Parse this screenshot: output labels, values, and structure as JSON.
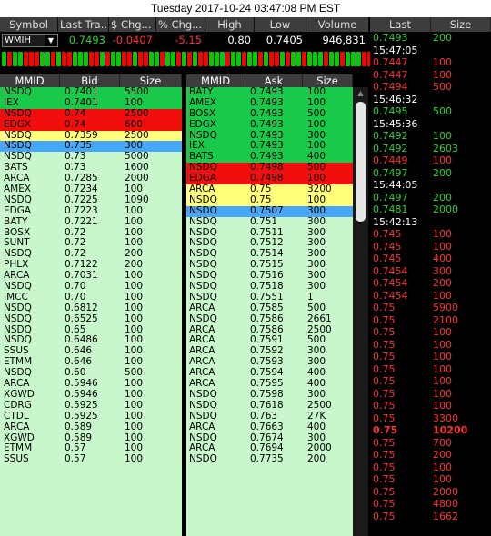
{
  "window": {
    "title": "Tuesday 2017-10-24 03:47:08 PM EST"
  },
  "quote": {
    "headers": {
      "symbol": "Symbol",
      "last": "Last Tra...",
      "chg": "$ Chg...",
      "pct": "% Chg...",
      "high": "High",
      "low": "Low",
      "volume": "Volume"
    },
    "symbol": "WMIH",
    "last": "0.7493",
    "chg": "-0.0407",
    "pct": "-5.15",
    "high": "0.80",
    "low": "0.7405",
    "volume": "946,831"
  },
  "tick_history": [
    "#0c0",
    "#f00",
    "#0c0",
    "#0c0",
    "#f00",
    "#f00",
    "#f00",
    "#0c0",
    "#0c0",
    "#f00",
    "#0c0",
    "#f00",
    "#f00",
    "#0c0",
    "#0c0",
    "#0c0",
    "#f00",
    "#f00",
    "#0c0",
    "#f00",
    "#0c0",
    "#0c0",
    "#f00",
    "#f00",
    "#0c0",
    "#f00",
    "#f00",
    "#0c0",
    "#0c0",
    "#f00",
    "#0c0",
    "#0c0",
    "#f00",
    "#0c0",
    "#f00",
    "#0c0",
    "#f00",
    "#f00",
    "#0c0",
    "#0c0",
    "#0c0",
    "#f00",
    "#0c0",
    "#0c0",
    "#f00",
    "#0c0",
    "#0c0",
    "#f00",
    "#0c0",
    "#f00",
    "#f00",
    "#0c0",
    "#f00",
    "#0c0",
    "#0c0",
    "#f00",
    "#0c0",
    "#0c0",
    "#0c0",
    "#f00",
    "#0c0",
    "#0c0",
    "#f00",
    "#0c0",
    "#0c0",
    "#0c0",
    "#f00",
    "#f00"
  ],
  "bid_panel": {
    "headers": {
      "mmid": "MMID",
      "price": "Bid",
      "size": "Size"
    },
    "rows": [
      {
        "mmid": "NSDQ",
        "price": "0.7401",
        "size": "5500",
        "color": "g"
      },
      {
        "mmid": "IEX",
        "price": "0.7401",
        "size": "100",
        "color": "g"
      },
      {
        "mmid": "NSDQ",
        "price": "0.74",
        "size": "2500",
        "color": "r"
      },
      {
        "mmid": "EDGX",
        "price": "0.74",
        "size": "600",
        "color": "r"
      },
      {
        "mmid": "NSDQ",
        "price": "0.7359",
        "size": "2500",
        "color": "y"
      },
      {
        "mmid": "NSDQ",
        "price": "0.735",
        "size": "300",
        "color": "b"
      },
      {
        "mmid": "NSDQ",
        "price": "0.73",
        "size": "5000",
        "color": "l"
      },
      {
        "mmid": "BATS",
        "price": "0.73",
        "size": "1600",
        "color": "l"
      },
      {
        "mmid": "ARCA",
        "price": "0.7285",
        "size": "2000",
        "color": "l"
      },
      {
        "mmid": "AMEX",
        "price": "0.7234",
        "size": "100",
        "color": "l"
      },
      {
        "mmid": "NSDQ",
        "price": "0.7225",
        "size": "1090",
        "color": "l"
      },
      {
        "mmid": "EDGA",
        "price": "0.7223",
        "size": "100",
        "color": "l"
      },
      {
        "mmid": "BATY",
        "price": "0.7221",
        "size": "100",
        "color": "l"
      },
      {
        "mmid": "BOSX",
        "price": "0.72",
        "size": "100",
        "color": "l"
      },
      {
        "mmid": "SUNT",
        "price": "0.72",
        "size": "100",
        "color": "l"
      },
      {
        "mmid": "NSDQ",
        "price": "0.72",
        "size": "200",
        "color": "l"
      },
      {
        "mmid": "PHLX",
        "price": "0.7122",
        "size": "200",
        "color": "l"
      },
      {
        "mmid": "ARCA",
        "price": "0.7031",
        "size": "100",
        "color": "l"
      },
      {
        "mmid": "NSDQ",
        "price": "0.70",
        "size": "100",
        "color": "l"
      },
      {
        "mmid": "IMCC",
        "price": "0.70",
        "size": "100",
        "color": "l"
      },
      {
        "mmid": "NSDQ",
        "price": "0.6812",
        "size": "100",
        "color": "l"
      },
      {
        "mmid": "NSDQ",
        "price": "0.6525",
        "size": "100",
        "color": "l"
      },
      {
        "mmid": "NSDQ",
        "price": "0.65",
        "size": "100",
        "color": "l"
      },
      {
        "mmid": "NSDQ",
        "price": "0.6486",
        "size": "100",
        "color": "l"
      },
      {
        "mmid": "SSUS",
        "price": "0.646",
        "size": "100",
        "color": "l"
      },
      {
        "mmid": "ETMM",
        "price": "0.646",
        "size": "100",
        "color": "l"
      },
      {
        "mmid": "NSDQ",
        "price": "0.60",
        "size": "500",
        "color": "l"
      },
      {
        "mmid": "ARCA",
        "price": "0.5946",
        "size": "100",
        "color": "l"
      },
      {
        "mmid": "XGWD",
        "price": "0.5946",
        "size": "100",
        "color": "l"
      },
      {
        "mmid": "CDRG",
        "price": "0.5925",
        "size": "100",
        "color": "l"
      },
      {
        "mmid": "CTDL",
        "price": "0.5925",
        "size": "100",
        "color": "l"
      },
      {
        "mmid": "ARCA",
        "price": "0.589",
        "size": "100",
        "color": "l"
      },
      {
        "mmid": "XGWD",
        "price": "0.589",
        "size": "100",
        "color": "l"
      },
      {
        "mmid": "ETMM",
        "price": "0.57",
        "size": "100",
        "color": "l"
      },
      {
        "mmid": "SSUS",
        "price": "0.57",
        "size": "100",
        "color": "l"
      }
    ]
  },
  "ask_panel": {
    "headers": {
      "mmid": "MMID",
      "price": "Ask",
      "size": "Size"
    },
    "rows": [
      {
        "mmid": "BATY",
        "price": "0.7493",
        "size": "100",
        "color": "g"
      },
      {
        "mmid": "AMEX",
        "price": "0.7493",
        "size": "100",
        "color": "g"
      },
      {
        "mmid": "BOSX",
        "price": "0.7493",
        "size": "500",
        "color": "g"
      },
      {
        "mmid": "EDGX",
        "price": "0.7493",
        "size": "100",
        "color": "g"
      },
      {
        "mmid": "NSDQ",
        "price": "0.7493",
        "size": "300",
        "color": "g"
      },
      {
        "mmid": "IEX",
        "price": "0.7493",
        "size": "100",
        "color": "g"
      },
      {
        "mmid": "BATS",
        "price": "0.7493",
        "size": "400",
        "color": "g"
      },
      {
        "mmid": "NSDQ",
        "price": "0.7498",
        "size": "500",
        "color": "r"
      },
      {
        "mmid": "EDGA",
        "price": "0.7498",
        "size": "100",
        "color": "r"
      },
      {
        "mmid": "ARCA",
        "price": "0.75",
        "size": "3200",
        "color": "y"
      },
      {
        "mmid": "NSDQ",
        "price": "0.75",
        "size": "100",
        "color": "y"
      },
      {
        "mmid": "NSDQ",
        "price": "0.7507",
        "size": "300",
        "color": "b"
      },
      {
        "mmid": "NSDQ",
        "price": "0.751",
        "size": "300",
        "color": "l"
      },
      {
        "mmid": "NSDQ",
        "price": "0.7511",
        "size": "300",
        "color": "l"
      },
      {
        "mmid": "NSDQ",
        "price": "0.7512",
        "size": "300",
        "color": "l"
      },
      {
        "mmid": "NSDQ",
        "price": "0.7514",
        "size": "300",
        "color": "l"
      },
      {
        "mmid": "NSDQ",
        "price": "0.7515",
        "size": "300",
        "color": "l"
      },
      {
        "mmid": "NSDQ",
        "price": "0.7516",
        "size": "300",
        "color": "l"
      },
      {
        "mmid": "NSDQ",
        "price": "0.7518",
        "size": "300",
        "color": "l"
      },
      {
        "mmid": "NSDQ",
        "price": "0.7551",
        "size": "1",
        "color": "l"
      },
      {
        "mmid": "ARCA",
        "price": "0.7585",
        "size": "500",
        "color": "l"
      },
      {
        "mmid": "NSDQ",
        "price": "0.7586",
        "size": "2661",
        "color": "l"
      },
      {
        "mmid": "ARCA",
        "price": "0.7586",
        "size": "2500",
        "color": "l"
      },
      {
        "mmid": "ARCA",
        "price": "0.7591",
        "size": "500",
        "color": "l"
      },
      {
        "mmid": "ARCA",
        "price": "0.7592",
        "size": "300",
        "color": "l"
      },
      {
        "mmid": "ARCA",
        "price": "0.7593",
        "size": "300",
        "color": "l"
      },
      {
        "mmid": "ARCA",
        "price": "0.7594",
        "size": "400",
        "color": "l"
      },
      {
        "mmid": "ARCA",
        "price": "0.7595",
        "size": "400",
        "color": "l"
      },
      {
        "mmid": "NSDQ",
        "price": "0.7598",
        "size": "300",
        "color": "l"
      },
      {
        "mmid": "NSDQ",
        "price": "0.7618",
        "size": "2500",
        "color": "l"
      },
      {
        "mmid": "NSDQ",
        "price": "0.763",
        "size": "27K",
        "color": "l"
      },
      {
        "mmid": "ARCA",
        "price": "0.7663",
        "size": "400",
        "color": "l"
      },
      {
        "mmid": "NSDQ",
        "price": "0.7674",
        "size": "300",
        "color": "l"
      },
      {
        "mmid": "ARCA",
        "price": "0.7694",
        "size": "2000",
        "color": "l"
      },
      {
        "mmid": "NSDQ",
        "price": "0.7735",
        "size": "200",
        "color": "l"
      }
    ]
  },
  "time_sales": {
    "headers": {
      "last": "Last",
      "size": "Size"
    },
    "rows": [
      {
        "price": "0.7493",
        "size": "200",
        "color": "#2ed12e"
      },
      {
        "time": "15:47:05"
      },
      {
        "price": "0.7447",
        "size": "100",
        "color": "#ff3030"
      },
      {
        "price": "0.7447",
        "size": "100",
        "color": "#ff3030"
      },
      {
        "price": "0.7494",
        "size": "500",
        "color": "#ff3030"
      },
      {
        "time": "15:46:32"
      },
      {
        "price": "0.7495",
        "size": "500",
        "color": "#2ed12e"
      },
      {
        "time": "15:45:36"
      },
      {
        "price": "0.7492",
        "size": "100",
        "color": "#2ed12e"
      },
      {
        "price": "0.7492",
        "size": "2603",
        "color": "#2ed12e"
      },
      {
        "price": "0.7449",
        "size": "100",
        "color": "#ff3030"
      },
      {
        "price": "0.7497",
        "size": "200",
        "color": "#2ed12e"
      },
      {
        "time": "15:44:05"
      },
      {
        "price": "0.7497",
        "size": "200",
        "color": "#2ed12e"
      },
      {
        "price": "0.7481",
        "size": "2000",
        "color": "#2ed12e"
      },
      {
        "time": "15:42:13"
      },
      {
        "price": "0.745",
        "size": "100",
        "color": "#ff3030"
      },
      {
        "price": "0.745",
        "size": "100",
        "color": "#ff3030"
      },
      {
        "price": "0.745",
        "size": "400",
        "color": "#ff3030"
      },
      {
        "price": "0.7454",
        "size": "300",
        "color": "#ff3030"
      },
      {
        "price": "0.7454",
        "size": "200",
        "color": "#ff3030"
      },
      {
        "price": "0.7454",
        "size": "100",
        "color": "#ff3030"
      },
      {
        "price": "0.75",
        "size": "5900",
        "color": "#ff3030"
      },
      {
        "price": "0.75",
        "size": "2100",
        "color": "#ff3030"
      },
      {
        "price": "0.75",
        "size": "100",
        "color": "#ff3030"
      },
      {
        "price": "0.75",
        "size": "100",
        "color": "#ff3030"
      },
      {
        "price": "0.75",
        "size": "100",
        "color": "#ff3030"
      },
      {
        "price": "0.75",
        "size": "100",
        "color": "#ff3030"
      },
      {
        "price": "0.75",
        "size": "100",
        "color": "#ff3030"
      },
      {
        "price": "0.75",
        "size": "100",
        "color": "#ff3030"
      },
      {
        "price": "0.75",
        "size": "100",
        "color": "#ff3030"
      },
      {
        "price": "0.75",
        "size": "3300",
        "color": "#ff3030"
      },
      {
        "price": "0.75",
        "size": "10200",
        "color": "#ff3030",
        "bold": true
      },
      {
        "price": "0.75",
        "size": "700",
        "color": "#ff3030"
      },
      {
        "price": "0.75",
        "size": "200",
        "color": "#ff3030"
      },
      {
        "price": "0.75",
        "size": "100",
        "color": "#ff3030"
      },
      {
        "price": "0.75",
        "size": "100",
        "color": "#ff3030"
      },
      {
        "price": "0.75",
        "size": "2000",
        "color": "#ff3030"
      },
      {
        "price": "0.75",
        "size": "4800",
        "color": "#ff3030"
      },
      {
        "price": "0.75",
        "size": "1662",
        "color": "#ff3030"
      }
    ]
  }
}
